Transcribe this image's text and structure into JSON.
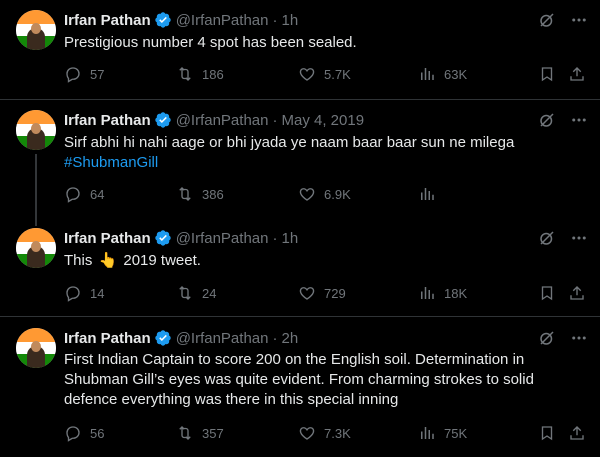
{
  "tweets": [
    {
      "author": "Irfan Pathan",
      "handle": "@IrfanPathan",
      "time": "1h",
      "text": "Prestigious number 4 spot has been sealed.",
      "replies": "57",
      "retweets": "186",
      "likes": "5.7K",
      "views": "63K"
    },
    {
      "author": "Irfan Pathan",
      "handle": "@IrfanPathan",
      "time": "May 4, 2019",
      "text": "Sirf abhi hi nahi aage or bhi jyada ye naam baar baar sun ne milega",
      "hashtag": "#ShubmanGill",
      "replies": "64",
      "retweets": "386",
      "likes": "6.9K",
      "views": ""
    },
    {
      "author": "Irfan Pathan",
      "handle": "@IrfanPathan",
      "time": "1h",
      "text_before": "This",
      "emoji": "👆",
      "text_after": "2019 tweet.",
      "replies": "14",
      "retweets": "24",
      "likes": "729",
      "views": "18K"
    },
    {
      "author": "Irfan Pathan",
      "handle": "@IrfanPathan",
      "time": "2h",
      "text": "First Indian Captain to score 200 on the English soil. Determination in Shubman Gill’s eyes was quite evident. From charming strokes to solid defence everything was there in this special inning",
      "replies": "56",
      "retweets": "357",
      "likes": "7.3K",
      "views": "75K"
    }
  ],
  "colors": {
    "background": "#000000",
    "text": "#e7e9ea",
    "muted": "#71767b",
    "link": "#1d9bf0",
    "verified": "#1d9bf0",
    "divider": "#2f3336"
  },
  "icons": [
    "verified-badge-icon",
    "grok-icon",
    "more-icon",
    "reply-icon",
    "retweet-icon",
    "like-icon",
    "views-icon",
    "bookmark-icon",
    "share-icon"
  ]
}
